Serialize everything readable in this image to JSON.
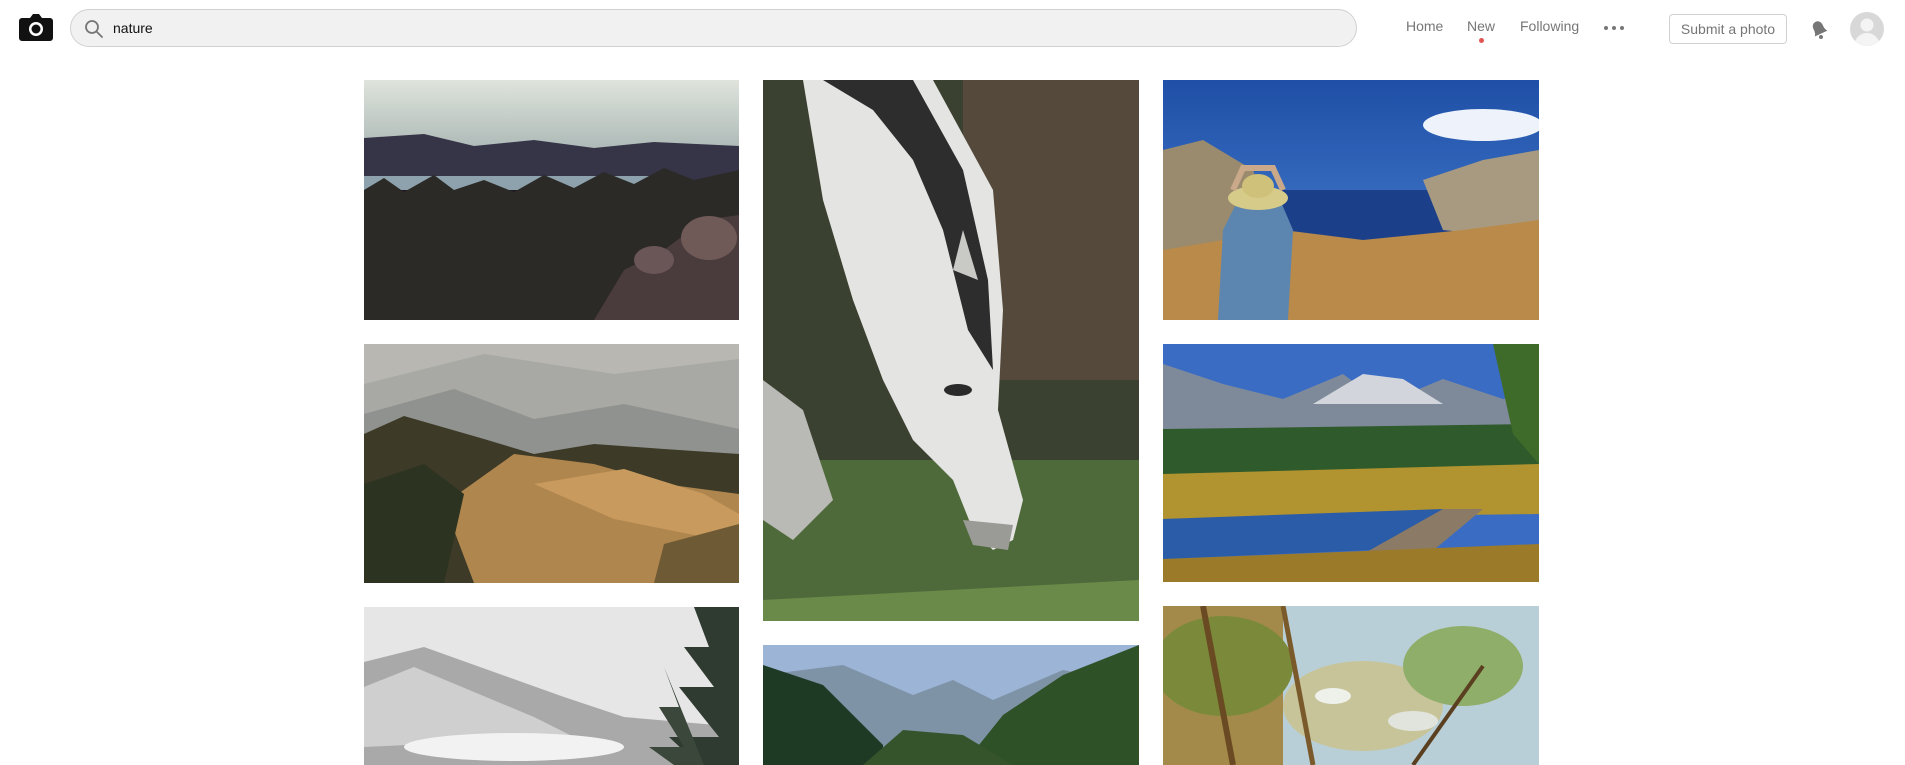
{
  "header": {
    "logo_icon": "camera-icon",
    "search": {
      "value": "nature",
      "icon": "search-icon"
    },
    "nav": {
      "home": "Home",
      "new": "New",
      "following": "Following",
      "more_icon": "more-dots-icon"
    },
    "submit_label": "Submit a photo",
    "notification_icon": "bell-icon",
    "avatar_icon": "avatar-icon",
    "colors": {
      "new_indicator": "#e25454",
      "nav_text": "#767676",
      "search_bg": "#f1f1f1"
    }
  },
  "gallery": {
    "photos": [
      {
        "column": 1,
        "subject": "mountain lake at dusk"
      },
      {
        "column": 1,
        "subject": "hazy hills with golden slope"
      },
      {
        "column": 1,
        "subject": "snowy mountains with pine trees"
      },
      {
        "column": 2,
        "subject": "white horse grazing"
      },
      {
        "column": 2,
        "subject": "forest valley with mountains"
      },
      {
        "column": 3,
        "subject": "woman in hat overlooking sea"
      },
      {
        "column": 3,
        "subject": "mountain lake with boardwalk"
      },
      {
        "column": 3,
        "subject": "blossoming branches"
      }
    ]
  }
}
